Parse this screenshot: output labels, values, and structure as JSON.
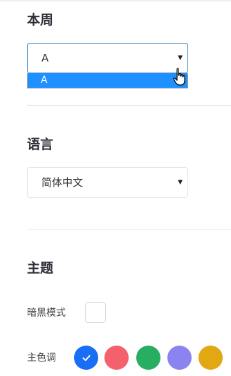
{
  "week": {
    "title": "本周",
    "select_value": "A",
    "options": [
      {
        "label": "A",
        "selected": true
      }
    ]
  },
  "language": {
    "title": "语言",
    "select_value": "简体中文"
  },
  "theme": {
    "title": "主题",
    "dark_mode_label": "暗黑模式",
    "dark_mode_checked": false,
    "primary_color_label": "主色调",
    "colors": [
      {
        "hex": "#1a6ef5",
        "selected": true,
        "icon": "check-icon"
      },
      {
        "hex": "#f4606c",
        "selected": false
      },
      {
        "hex": "#27ae60",
        "selected": false
      },
      {
        "hex": "#8b84f0",
        "selected": false
      },
      {
        "hex": "#e2a813",
        "selected": false
      }
    ]
  },
  "icons": {
    "caret": "caret-down-icon",
    "cursor": "hand-pointer-icon"
  }
}
